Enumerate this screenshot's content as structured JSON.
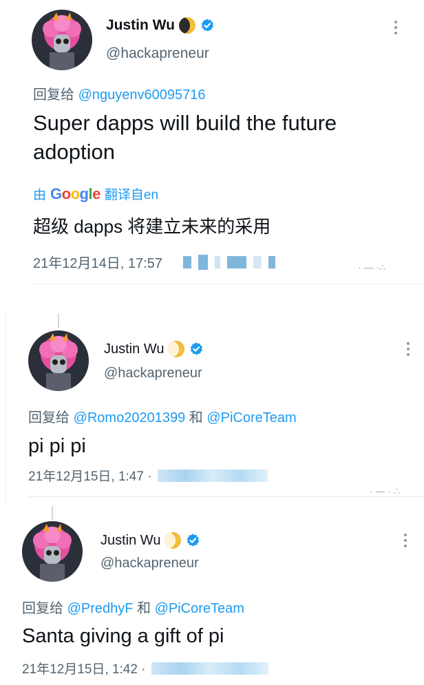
{
  "tweets": [
    {
      "display_name": "Justin Wu",
      "handle": "@hackapreneur",
      "reply_prefix": "回复给",
      "reply_mentions": [
        "@nguyenv60095716"
      ],
      "reply_joiner": "",
      "text": "Super dapps will build the future adoption",
      "translate_prefix": "由",
      "translate_brand": "Google",
      "translate_suffix": "翻译自en",
      "translated_text": "超级 dapps 将建立未来的采用",
      "timestamp": "21年12月14日, 17:57"
    },
    {
      "display_name": "Justin Wu",
      "handle": "@hackapreneur",
      "reply_prefix": "回复给",
      "reply_mentions": [
        "@Romo20201399",
        "@PiCoreTeam"
      ],
      "reply_joiner": "和",
      "text": "pi pi pi",
      "timestamp": "21年12月15日, 1:47 ·"
    },
    {
      "display_name": "Justin Wu",
      "handle": "@hackapreneur",
      "reply_prefix": "回复给",
      "reply_mentions": [
        "@PredhyF",
        "@PiCoreTeam"
      ],
      "reply_joiner": "和",
      "text": "Santa giving a gift of pi",
      "timestamp": "21年12月15日, 1:42 ·"
    }
  ],
  "colors": {
    "accent": "#1d9bf0",
    "secondary_text": "#536471",
    "primary_text": "#0f1419"
  },
  "icons": {
    "badge": "verified-badge-icon",
    "emoji": "moon-emoji-icon",
    "menu": "more-options-icon"
  }
}
